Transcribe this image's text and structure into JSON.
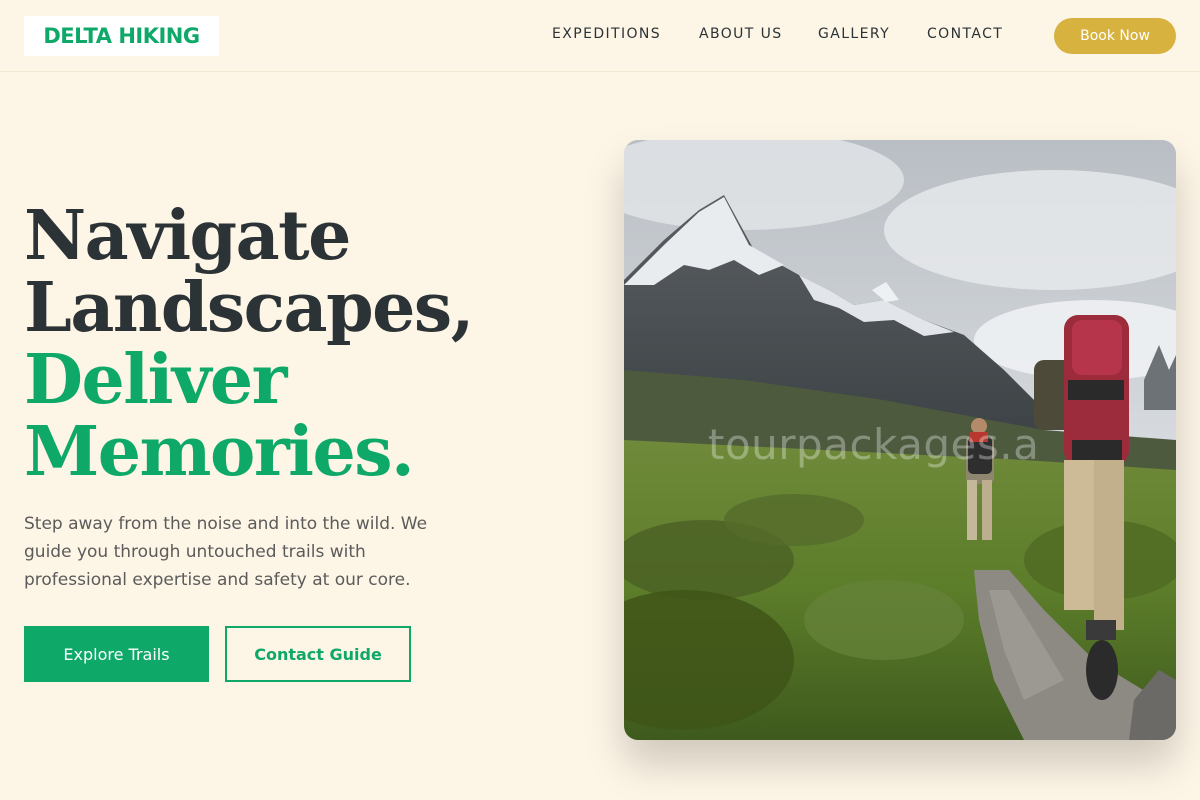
{
  "brand": {
    "name": "DELTA HIKING",
    "color": "#0ea869"
  },
  "nav": {
    "items": [
      {
        "label": "EXPEDITIONS"
      },
      {
        "label": "ABOUT US"
      },
      {
        "label": "GALLERY"
      },
      {
        "label": "CONTACT"
      }
    ],
    "cta_label": "Book Now"
  },
  "hero": {
    "headline": {
      "line1": "Navigate",
      "line2": "Landscapes,",
      "line3": "Deliver",
      "line4": "Memories."
    },
    "subtitle": "Step away from the noise and into the wild. We guide you through untouched trails with professional expertise and safety at our core.",
    "primary_button": "Explore Trails",
    "secondary_button": "Contact Guide",
    "image": {
      "watermark_text": "tourpackages.a"
    }
  },
  "colors": {
    "background": "#fdf5e6",
    "accent_green": "#0ea869",
    "accent_gold": "#d8b23e",
    "text_dark": "#2b3336"
  }
}
